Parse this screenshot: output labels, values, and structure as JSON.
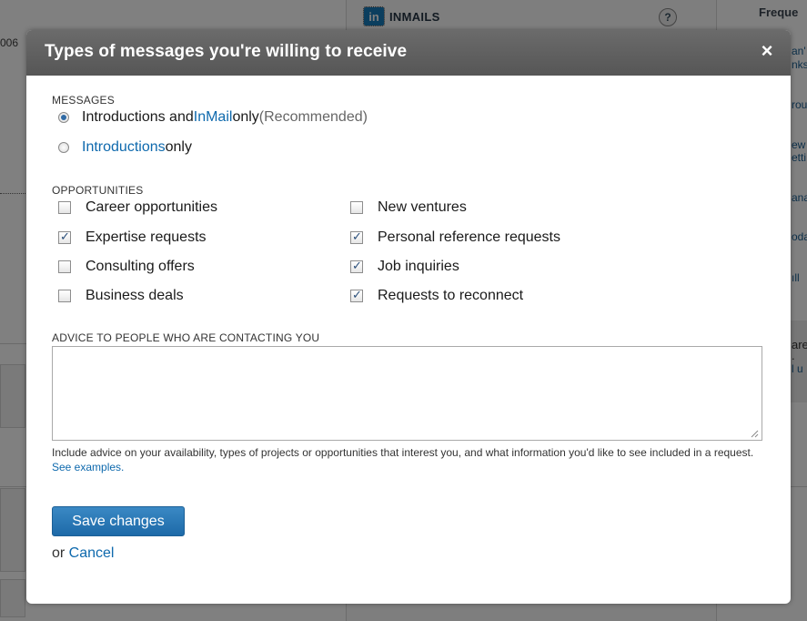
{
  "background": {
    "left_number": "006",
    "inmails_logo": "in",
    "inmails_label": "INMAILS",
    "help_symbol": "?",
    "right_heading": "Freque",
    "right_fragments": [
      "an'",
      "nks",
      "rou",
      "ew",
      "etti",
      "ana",
      "oda",
      "ıll",
      "are",
      ".",
      "l u"
    ]
  },
  "modal": {
    "title": "Types of messages you're willing to receive",
    "close_symbol": "×",
    "messages": {
      "label": "MESSAGES",
      "options": [
        {
          "pre": "Introductions and ",
          "link": "InMail",
          "post": " only",
          "note": " (Recommended)",
          "checked": true
        },
        {
          "pre": "",
          "link": "Introductions",
          "post": " only",
          "note": "",
          "checked": false
        }
      ]
    },
    "opportunities": {
      "label": "OPPORTUNITIES",
      "left": [
        {
          "label": "Career opportunities",
          "checked": false
        },
        {
          "label": "Expertise requests",
          "checked": true
        },
        {
          "label": "Consulting offers",
          "checked": false
        },
        {
          "label": "Business deals",
          "checked": false
        }
      ],
      "right": [
        {
          "label": "New ventures",
          "checked": false
        },
        {
          "label": "Personal reference requests",
          "checked": true
        },
        {
          "label": "Job inquiries",
          "checked": true
        },
        {
          "label": "Requests to reconnect",
          "checked": true
        }
      ]
    },
    "advice": {
      "label": "ADVICE TO PEOPLE WHO ARE CONTACTING YOU",
      "value": "",
      "help_text": "Include advice on your availability, types of projects or opportunities that interest you, and what information you'd like to see included in a request. ",
      "help_link": "See examples."
    },
    "save_label": "Save changes",
    "or_text": "or ",
    "cancel_label": "Cancel"
  }
}
